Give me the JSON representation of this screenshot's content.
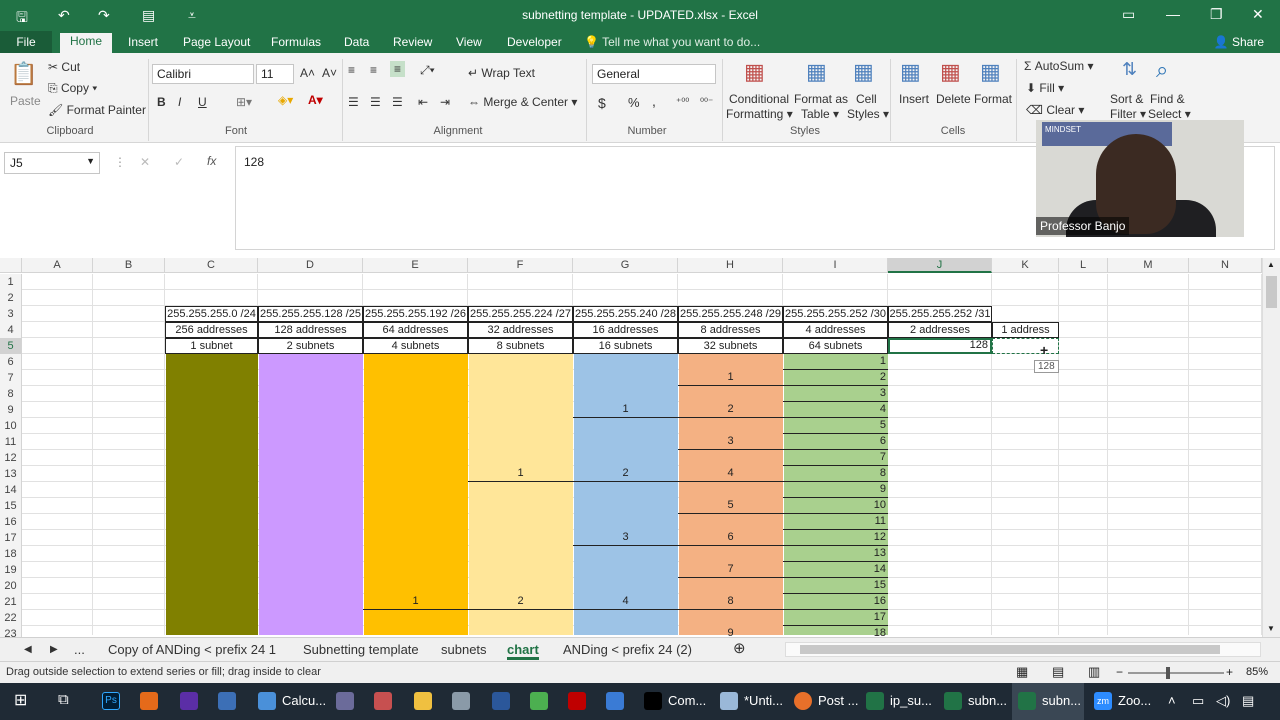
{
  "window": {
    "title": "subnetting template - UPDATED.xlsx - Excel"
  },
  "ribbon_tabs": [
    "File",
    "Home",
    "Insert",
    "Page Layout",
    "Formulas",
    "Data",
    "Review",
    "View",
    "Developer"
  ],
  "tell_me": "Tell me what you want to do...",
  "share": "Share",
  "clipboard": {
    "paste": "Paste",
    "cut": "Cut",
    "copy": "Copy",
    "format_painter": "Format Painter",
    "group": "Clipboard"
  },
  "font": {
    "name": "Calibri",
    "size": "11",
    "group": "Font",
    "bold": "B",
    "italic": "I",
    "underline": "U"
  },
  "alignment": {
    "wrap": "Wrap Text",
    "merge": "Merge & Center",
    "group": "Alignment"
  },
  "number": {
    "format": "General",
    "group": "Number",
    "currency": "$",
    "percent": "%",
    "comma": ","
  },
  "styles": {
    "conditional": "Conditional",
    "conditional2": "Formatting",
    "format_table": "Format as",
    "format_table2": "Table",
    "cell_styles": "Cell",
    "cell_styles2": "Styles",
    "group": "Styles"
  },
  "cells": {
    "insert": "Insert",
    "delete": "Delete",
    "format": "Format",
    "group": "Cells"
  },
  "editing": {
    "autosum": "AutoSum",
    "fill": "Fill",
    "clear": "Clear",
    "sort": "Sort &",
    "sort2": "Filter",
    "find": "Find &",
    "find2": "Select"
  },
  "formula_bar": {
    "name_box": "J5",
    "fx": "fx",
    "value": "128"
  },
  "columns": [
    "A",
    "B",
    "C",
    "D",
    "E",
    "F",
    "G",
    "H",
    "I",
    "J",
    "K",
    "L",
    "M",
    "N"
  ],
  "rows": [
    "1",
    "2",
    "3",
    "4",
    "5",
    "6",
    "7",
    "8",
    "9",
    "10",
    "11",
    "12",
    "13",
    "14",
    "15",
    "16",
    "17",
    "18",
    "19",
    "20",
    "21",
    "22",
    "23"
  ],
  "headers": {
    "row3": [
      "255.255.255.0 /24",
      "255.255.255.128 /25",
      "255.255.255.192 /26",
      "255.255.255.224 /27",
      "255.255.255.240 /28",
      "255.255.255.248 /29",
      "255.255.255.252 /30",
      "255.255.255.252 /31"
    ],
    "row4": [
      "256 addresses",
      "128 addresses",
      "64 addresses",
      "32 addresses",
      "16 addresses",
      "8 addresses",
      "4 addresses",
      "2 addresses",
      "1 address"
    ],
    "row5": [
      "1 subnet",
      "2 subnets",
      "4 subnets",
      "8 subnets",
      "16 subnets",
      "32 subnets",
      "64 subnets"
    ]
  },
  "j5": "128",
  "tooltip": "128",
  "col_e": [
    "1"
  ],
  "col_f": [
    "1",
    "2"
  ],
  "col_g": [
    "1",
    "2",
    "3",
    "4"
  ],
  "col_h": [
    "1",
    "2",
    "3",
    "4",
    "5",
    "6",
    "7",
    "8",
    "9"
  ],
  "col_i": [
    "1",
    "2",
    "3",
    "4",
    "5",
    "6",
    "7",
    "8",
    "9",
    "10",
    "11",
    "12",
    "13",
    "14",
    "15",
    "16",
    "17",
    "18"
  ],
  "colors": {
    "c": "#808000",
    "d": "#cc99ff",
    "e": "#ffc000",
    "f": "#ffe699",
    "g": "#9dc3e6",
    "h": "#f4b183",
    "i": "#a9d08e",
    "excel_green": "#217346"
  },
  "sheet_tabs": [
    "...",
    "Copy of ANDing < prefix 24 1",
    "Subnetting template",
    "subnets",
    "chart",
    "ANDing < prefix 24 (2)"
  ],
  "active_sheet": "chart",
  "status": {
    "message": "Drag outside selection to extend series or fill; drag inside to clear",
    "zoom": "85%"
  },
  "webcam": {
    "name": "Professor Banjo",
    "sign": "MINDSET"
  },
  "taskbar": [
    "Calcu...",
    "Com...",
    "*Unti...",
    "Post ...",
    "ip_su...",
    "subn...",
    "subn...",
    "Zoo..."
  ]
}
